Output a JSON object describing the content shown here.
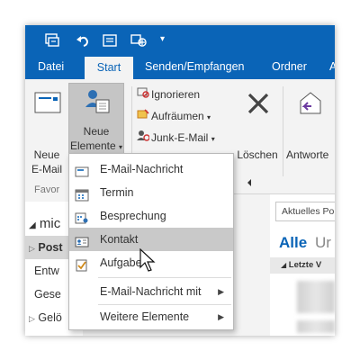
{
  "ribbon_tabs": [
    "Datei",
    "Start",
    "Senden/Empfangen",
    "Ordner"
  ],
  "home_group": {
    "neue_email": [
      "Neue",
      "E-Mail"
    ],
    "neue_elemente": [
      "Neue",
      "Elemente"
    ]
  },
  "delete_group": {
    "ignorieren": "Ignorieren",
    "aufraeumen": "Aufräumen",
    "junk": "Junk-E-Mail",
    "loeschen": "Löschen"
  },
  "respond_group": {
    "antworten": "Antworte"
  },
  "left_pane": {
    "favorites_label": "Favor",
    "items": [
      "mic",
      "Post",
      "Entw",
      "Gese",
      "Gelö"
    ]
  },
  "right_pane": {
    "search_placeholder": "Aktuelles Po",
    "filter_all": "Alle",
    "filter_unread": "Ur",
    "group_header": "Letzte V"
  },
  "new_items_menu": {
    "items": [
      {
        "label": "E-Mail-Nachricht",
        "icon": "email-icon"
      },
      {
        "label": "Termin",
        "icon": "calendar-icon"
      },
      {
        "label": "Besprechung",
        "icon": "meeting-icon"
      },
      {
        "label": "Kontakt",
        "icon": "contact-icon"
      },
      {
        "label": "Aufgabe",
        "icon": "task-icon"
      },
      {
        "label": "E-Mail-Nachricht mit",
        "icon": "submenu-arrow"
      },
      {
        "label": "Weitere Elemente",
        "icon": "submenu-arrow"
      }
    ]
  },
  "colors": {
    "outlook_blue": "#0a64b7",
    "ribbon_bg": "#f3f3f3",
    "hover_gray": "#c9c9c9"
  }
}
